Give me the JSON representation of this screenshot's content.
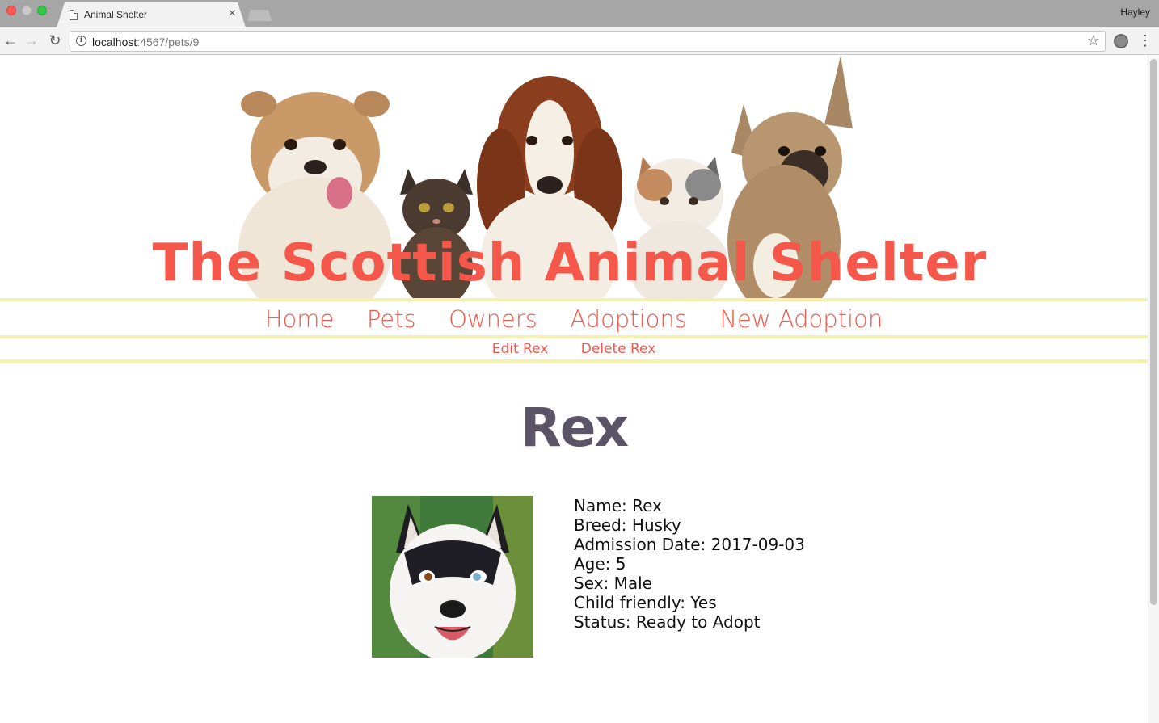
{
  "browser": {
    "tab_title": "Animal Shelter",
    "tab_close": "×",
    "profile_name": "Hayley",
    "url_host": "localhost",
    "url_path": ":4567/pets/9",
    "back_icon": "←",
    "forward_icon": "→",
    "reload_icon": "↻",
    "star_icon": "☆",
    "menu_icon": "⋮",
    "info_icon": "i"
  },
  "site": {
    "title": "The Scottish Animal Shelter",
    "title_color": "#f5574a",
    "banner_image": "dogs-and-cats-banner"
  },
  "nav": {
    "main": [
      "Home",
      "Pets",
      "Owners",
      "Adoptions",
      "New Adoption"
    ],
    "sub": [
      "Edit Rex",
      "Delete Rex"
    ]
  },
  "pet": {
    "heading": "Rex",
    "photo": "husky-photo",
    "details": [
      "Name: Rex",
      "Breed: Husky",
      "Admission Date: 2017-09-03",
      "Age: 5",
      "Sex: Male",
      "Child friendly: Yes",
      "Status: Ready to Adopt"
    ]
  },
  "colors": {
    "accent": "#f5574a",
    "heading": "#5b5366",
    "divider": "#f3f0b0"
  }
}
